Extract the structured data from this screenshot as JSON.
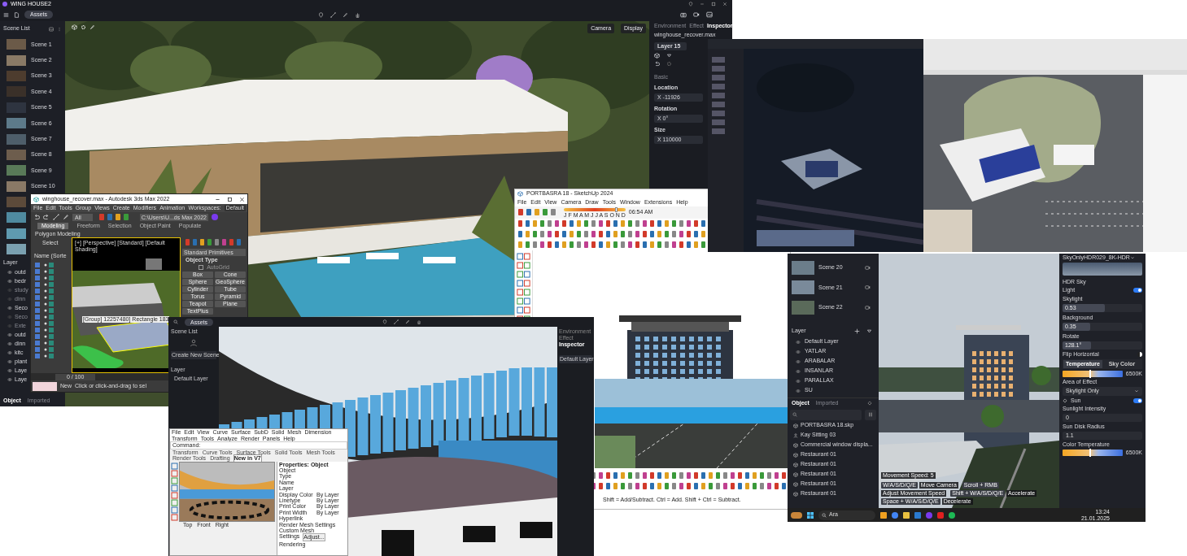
{
  "main_app": {
    "title": "WING HOUSE2",
    "assets_button": "Assets",
    "scene_list_title": "Scene List",
    "scenes": [
      "Scene 1",
      "Scene 2",
      "Scene 3",
      "Scene 4",
      "Scene 5",
      "Scene 6",
      "Scene 7",
      "Scene 8",
      "Scene 9",
      "Scene 10"
    ],
    "layer_title": "Layer",
    "layers": [
      {
        "label": "outd",
        "visible": true
      },
      {
        "label": "bedr",
        "visible": true
      },
      {
        "label": "study",
        "visible": false
      },
      {
        "label": "dinn",
        "visible": false
      },
      {
        "label": "Seco",
        "visible": true
      },
      {
        "label": "Seco",
        "visible": false
      },
      {
        "label": "Exte",
        "visible": false
      },
      {
        "label": "outd",
        "visible": true
      },
      {
        "label": "dinn",
        "visible": true
      },
      {
        "label": "kitc",
        "visible": true
      },
      {
        "label": "plant",
        "visible": true
      },
      {
        "label": "Laye",
        "visible": true
      },
      {
        "label": "Laye",
        "visible": true
      }
    ],
    "bottom_tabs": [
      {
        "label": "Object",
        "selected": true
      },
      {
        "label": "Imported",
        "selected": false
      }
    ],
    "view_buttons": [
      "Camera",
      "Display"
    ]
  },
  "inspector": {
    "tabs": [
      {
        "label": "Environment",
        "selected": false
      },
      {
        "label": "Effect",
        "selected": false
      },
      {
        "label": "Inspector",
        "selected": true
      }
    ],
    "file": "winghouse_recover.max",
    "layer": "Layer 15",
    "section": "Basic",
    "fields": [
      {
        "label": "Location",
        "value": "X -11926"
      },
      {
        "label": "Rotation",
        "value": "X 0°"
      },
      {
        "label": "Size",
        "value": "X 110000"
      }
    ]
  },
  "max_window": {
    "title": "winghouse_recover.max - Autodesk 3ds Max 2022",
    "menu": [
      "File",
      "Edit",
      "Tools",
      "Group",
      "Views",
      "Create",
      "Modifiers",
      "Animation"
    ],
    "workspace_label": "Workspaces:",
    "workspace_value": "Default",
    "selection_filter": "All",
    "path": "C:\\Users\\U...ds Max 2022",
    "ribbon_tabs": [
      {
        "label": "Modeling",
        "selected": true
      },
      {
        "label": "Freeform",
        "selected": false
      },
      {
        "label": "Selection",
        "selected": false
      },
      {
        "label": "Object Paint",
        "selected": false
      },
      {
        "label": "Populate",
        "selected": false
      }
    ],
    "ribbon_subtab": "Polygon Modeling",
    "select_label": "Select",
    "name_column": "Name (Sorte",
    "viewport_label": "[+] [Perspective] [Standard] [Default Shading]",
    "tooltip": "[Group] 12257480] Rectangle 183",
    "rollout": "Standard Primitives",
    "object_type": "Object Type",
    "autogrid": {
      "label": "AutoGrid",
      "checked": false
    },
    "primitives": [
      "Box",
      "Cone",
      "Sphere",
      "GeoSphere",
      "Cylinder",
      "Tube",
      "Torus",
      "Pyramid",
      "Teapot",
      "Plane",
      "TextPlus"
    ],
    "frame": "0 / 100",
    "new_label": "New",
    "prompt": "Click or click-and-drag to sel"
  },
  "sketchup_window": {
    "title": "PORTBASRA 18 - SketchUp 2024",
    "menu": [
      "File",
      "Edit",
      "View",
      "Camera",
      "Draw",
      "Tools",
      "Window",
      "Extensions",
      "Help"
    ],
    "sun": {
      "level": 0.83
    },
    "months": "J F M A M J J A S O N D",
    "time": "06:54 AM",
    "status": "Shift = Add/Subtract. Ctrl = Add. Shift + Ctrl = Subtract."
  },
  "d5_window": {
    "scenes": [
      "Scene 20",
      "Scene 21",
      "Scene 22"
    ],
    "layer_title": "Layer",
    "layers": [
      "Default Layer",
      "YATLAR",
      "ARABALAR",
      "INSANLAR",
      "PARALLAX",
      "SU"
    ],
    "object_tabs": [
      {
        "label": "Object",
        "selected": true
      },
      {
        "label": "Imported",
        "selected": false
      }
    ],
    "objects": [
      {
        "label": "PORTBASRA 18.skp",
        "kind": "model"
      },
      {
        "label": "Kay Sitting 03",
        "kind": "person"
      },
      {
        "label": "Commercial window displa...",
        "kind": "model"
      },
      {
        "label": "Restaurant 01",
        "kind": "model"
      },
      {
        "label": "Restaurant 01",
        "kind": "model"
      },
      {
        "label": "Restaurant 01",
        "kind": "model"
      },
      {
        "label": "Restaurant 01",
        "kind": "model"
      },
      {
        "label": "Restaurant 01",
        "kind": "model"
      }
    ],
    "movement_speed": "Movement Speed: 5",
    "hints": [
      {
        "key": "W/A/S/D/Q/E",
        "action": "Move Camera"
      },
      {
        "key": "Scroll + RMB",
        "action": "Adjust Movement Speed"
      },
      {
        "key": "Shift + W/A/S/D/Q/E",
        "action": "Accelerate"
      },
      {
        "key": "Space + W/A/S/D/Q/E",
        "action": "Decelerate"
      }
    ],
    "sky": {
      "hdr_name": "SkyOnlyHDR029_8K-HDR",
      "hdr_sky": "HDR Sky",
      "light": "Light",
      "light_on": true,
      "fields": [
        {
          "label": "Skylight",
          "value": "0.53",
          "level": 0.53
        },
        {
          "label": "Background",
          "value": "0.35",
          "level": 0.35
        },
        {
          "label": "Rotate",
          "value": "128.1°",
          "level": 0.36
        }
      ],
      "flip": "Flip Horizontal",
      "color_tabs": [
        {
          "label": "Temperature",
          "selected": true
        },
        {
          "label": "Sky Color",
          "selected": false
        }
      ],
      "temperature": {
        "value": "6500K",
        "level": 0.45
      },
      "area_label": "Area of Effect",
      "area_value": "Skylight Only",
      "sun": "Sun",
      "sun_on": true,
      "sun_fields": [
        {
          "label": "Sunlight Intensity",
          "value": "0"
        },
        {
          "label": "Sun Disk Radius",
          "value": "1.1"
        }
      ],
      "color_temp_label": "Color Temperature",
      "color_temp": {
        "value": "6500K",
        "level": 0.45
      }
    },
    "taskbar": {
      "search": "Ara",
      "time": "13:24",
      "date": "21.01.2025"
    }
  },
  "d5_second": {
    "assets_button": "Assets",
    "scene_list_title": "Scene List",
    "create_scene": "Create New Scene",
    "layer_title": "Layer",
    "layer": "Default Layer",
    "tabs": [
      {
        "label": "Environment",
        "selected": false
      },
      {
        "label": "Effect",
        "selected": false
      },
      {
        "label": "Inspector",
        "selected": true
      }
    ],
    "panel_layer": "Default Layer"
  },
  "rhino": {
    "menu": [
      "File",
      "Edit",
      "View",
      "Curve",
      "Surface",
      "SubD",
      "Solid",
      "Mesh",
      "Dimension",
      "Transform",
      "Tools",
      "Analyze",
      "Render",
      "Panels",
      "Help"
    ],
    "command_line": "Command:",
    "tabs": [
      {
        "label": "Transform",
        "selected": false
      },
      {
        "label": "Curve Tools",
        "selected": false
      },
      {
        "label": "Surface Tools",
        "selected": false
      },
      {
        "label": "Solid Tools",
        "selected": false
      },
      {
        "label": "Mesh Tools",
        "selected": false
      },
      {
        "label": "Render Tools",
        "selected": false
      },
      {
        "label": "Drafting",
        "selected": false
      },
      {
        "label": "New in V7",
        "selected": true
      }
    ],
    "properties_title": "Properties: Object",
    "section": "Object",
    "props": [
      {
        "label": "Type"
      },
      {
        "label": "Name"
      },
      {
        "label": "Layer"
      },
      {
        "label": "Display Color",
        "value": "By Layer"
      },
      {
        "label": "Linetype",
        "value": "By Layer"
      },
      {
        "label": "Print Color",
        "value": "By Layer"
      },
      {
        "label": "Print Width",
        "value": "By Layer"
      },
      {
        "label": "Hyperlink"
      }
    ],
    "mesh_section": "Render Mesh Settings",
    "custom_mesh": "Custom Mesh",
    "settings": "Settings",
    "adjust": "Adjust...",
    "rendering": "Rendering",
    "views": [
      "Top",
      "Front",
      "Right"
    ]
  }
}
